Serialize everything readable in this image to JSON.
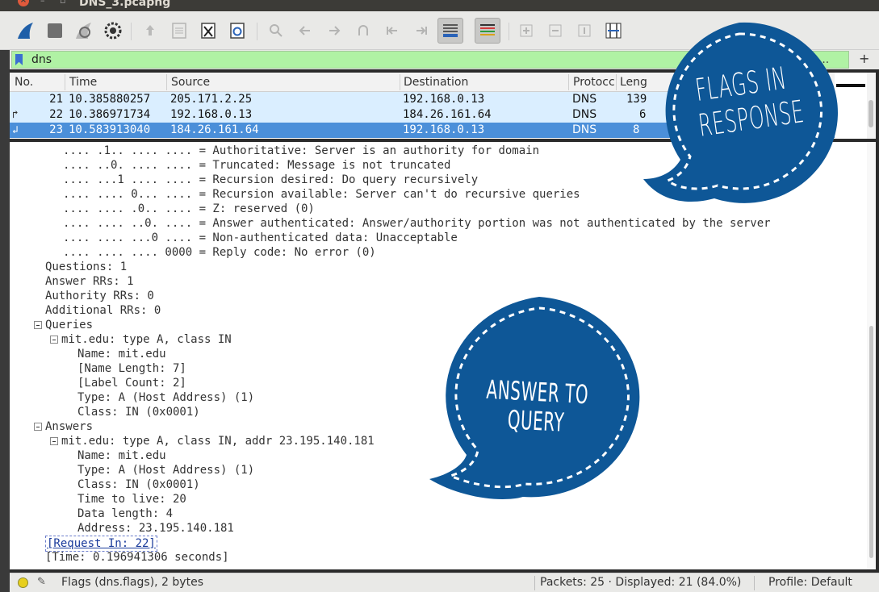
{
  "window": {
    "title": "DNS_3.pcapng"
  },
  "toolbar": {
    "buttons": [
      {
        "icon": "shark-fin-icon"
      },
      {
        "icon": "stop-square-icon"
      },
      {
        "icon": "restart-fin-icon"
      },
      {
        "icon": "gear-options-icon"
      },
      {
        "icon": "open-file-icon"
      },
      {
        "icon": "save-file-icon"
      },
      {
        "icon": "close-file-icon"
      },
      {
        "icon": "reload-icon"
      },
      {
        "icon": "search-icon"
      },
      {
        "icon": "go-back-icon"
      },
      {
        "icon": "go-forward-icon"
      },
      {
        "icon": "go-to-packet-icon"
      },
      {
        "icon": "first-packet-icon"
      },
      {
        "icon": "last-packet-icon"
      },
      {
        "icon": "autoscroll-icon"
      },
      {
        "icon": "colorize-icon"
      },
      {
        "icon": "zoom-in-icon"
      },
      {
        "icon": "zoom-out-icon"
      },
      {
        "icon": "normal-size-icon"
      },
      {
        "icon": "resize-columns-icon"
      }
    ]
  },
  "filter": {
    "value": "dns",
    "expression_label": "n...",
    "add_label": "+"
  },
  "packet_list": {
    "columns": [
      "No.",
      "Time",
      "Source",
      "Destination",
      "Protocc",
      "Leng"
    ],
    "rows": [
      {
        "no": "21",
        "time": "10.385880257",
        "source": "205.171.2.25",
        "destination": "192.168.0.13",
        "protocol": "DNS",
        "length": "139"
      },
      {
        "no": "22",
        "time": "10.386971734",
        "source": "192.168.0.13",
        "destination": "184.26.161.64",
        "protocol": "DNS",
        "length": "6"
      },
      {
        "no": "23",
        "time": "10.583913040",
        "source": "184.26.161.64",
        "destination": "192.168.0.13",
        "protocol": "DNS",
        "length": "8"
      }
    ]
  },
  "details": {
    "flags": [
      ".... .1.. .... .... = Authoritative: Server is an authority for domain",
      ".... ..0. .... .... = Truncated: Message is not truncated",
      ".... ...1 .... .... = Recursion desired: Do query recursively",
      ".... .... 0... .... = Recursion available: Server can't do recursive queries",
      ".... .... .0.. .... = Z: reserved (0)",
      ".... .... ..0. .... = Answer authenticated: Answer/authority portion was not authenticated by the server",
      ".... .... ...0 .... = Non-authenticated data: Unacceptable",
      ".... .... .... 0000 = Reply code: No error (0)"
    ],
    "counts": [
      "Questions: 1",
      "Answer RRs: 1",
      "Authority RRs: 0",
      "Additional RRs: 0"
    ],
    "queries_label": "Queries",
    "query_entry": "mit.edu: type A, class IN",
    "query_fields": [
      "Name: mit.edu",
      "[Name Length: 7]",
      "[Label Count: 2]",
      "Type: A (Host Address) (1)",
      "Class: IN (0x0001)"
    ],
    "answers_label": "Answers",
    "answer_entry": "mit.edu: type A, class IN, addr 23.195.140.181",
    "answer_fields": [
      "Name: mit.edu",
      "Type: A (Host Address) (1)",
      "Class: IN (0x0001)",
      "Time to live: 20",
      "Data length: 4",
      "Address: 23.195.140.181"
    ],
    "request_in": "[Request In: 22]",
    "time": "[Time: 0.196941306 seconds]"
  },
  "status": {
    "field": "Flags (dns.flags), 2 bytes",
    "packets": "Packets: 25 · Displayed: 21 (84.0%)",
    "profile": "Profile: Default"
  },
  "annotations": {
    "bubble1": "Flags in response",
    "bubble2": "Answer to query",
    "bubble_color": "#0e5797"
  }
}
